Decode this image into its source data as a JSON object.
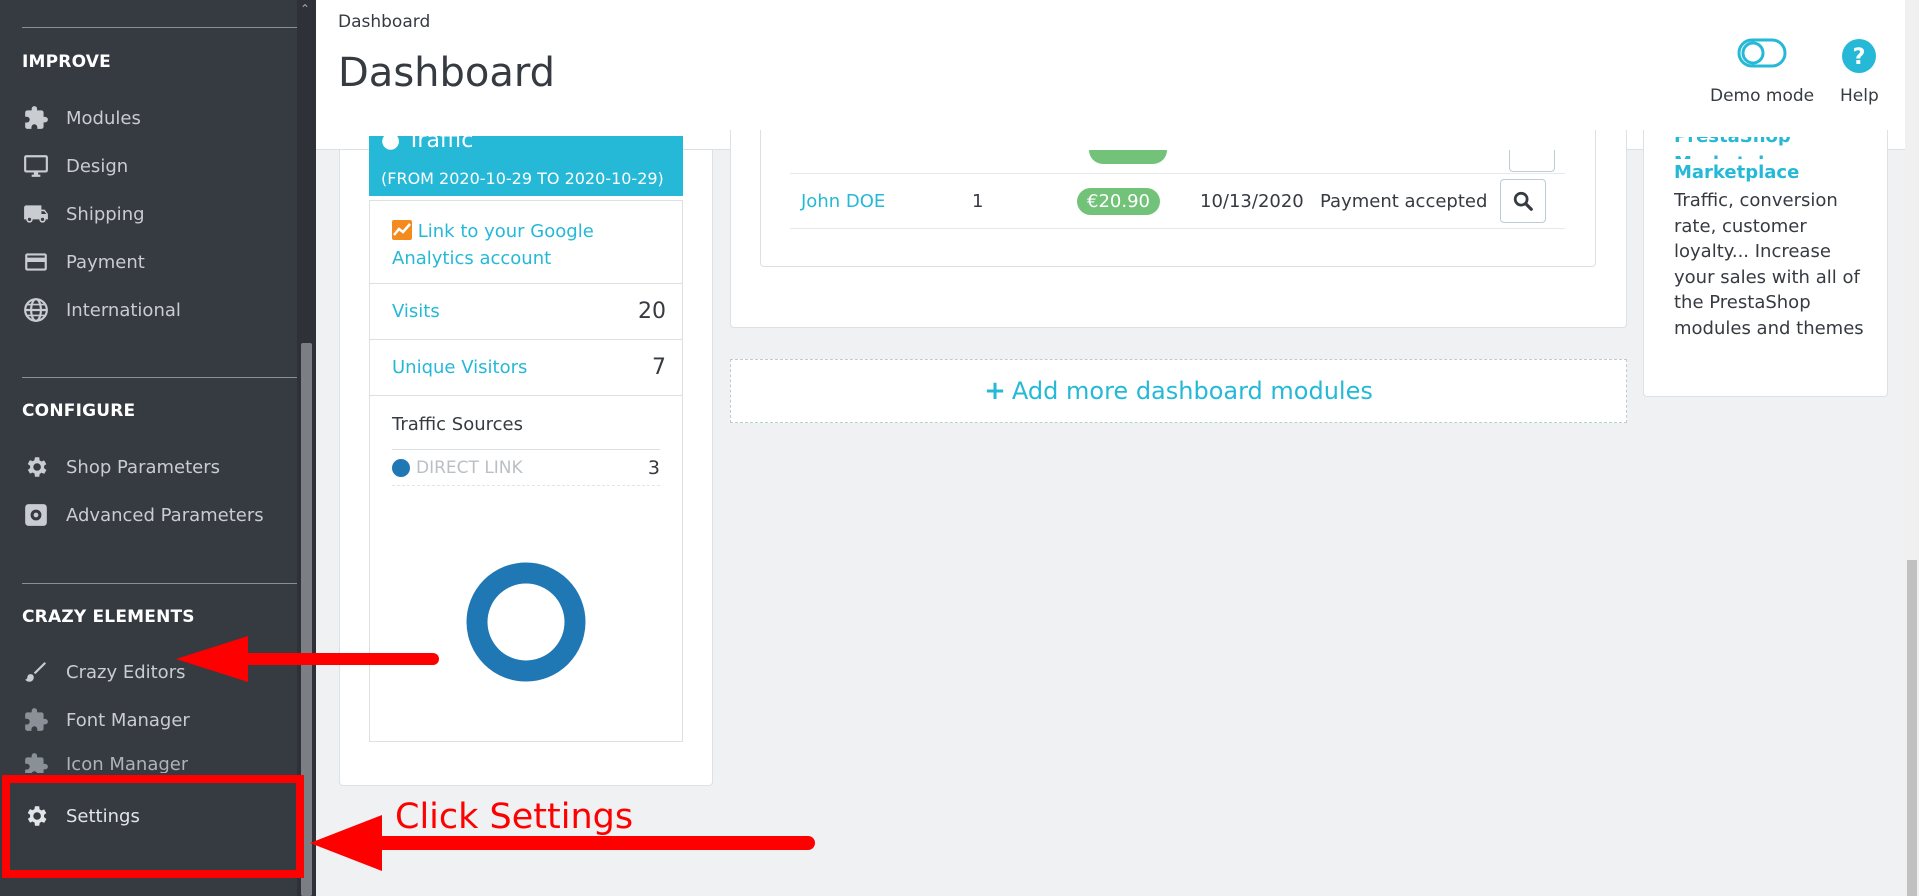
{
  "sidebar": {
    "sections": [
      {
        "title": "IMPROVE",
        "items": [
          {
            "label": "Modules",
            "icon": "puzzle-icon"
          },
          {
            "label": "Design",
            "icon": "monitor-icon"
          },
          {
            "label": "Shipping",
            "icon": "truck-icon"
          },
          {
            "label": "Payment",
            "icon": "credit-card-icon"
          },
          {
            "label": "International",
            "icon": "globe-icon"
          }
        ]
      },
      {
        "title": "CONFIGURE",
        "items": [
          {
            "label": "Shop Parameters",
            "icon": "gear-icon"
          },
          {
            "label": "Advanced Parameters",
            "icon": "gear-box-icon"
          }
        ]
      },
      {
        "title": "CRAZY ELEMENTS",
        "items": [
          {
            "label": "Crazy Editors",
            "icon": "brush-icon"
          },
          {
            "label": "Font Manager",
            "icon": "puzzle-icon"
          },
          {
            "label": "Icon Manager",
            "icon": "puzzle-icon"
          },
          {
            "label": "Settings",
            "icon": "gear-icon"
          }
        ]
      }
    ]
  },
  "header": {
    "breadcrumb": "Dashboard",
    "title": "Dashboard",
    "demo_mode": "Demo mode",
    "help": "Help"
  },
  "analytics": {
    "title": "Traffic",
    "range": "(FROM 2020-10-29 TO 2020-10-29)",
    "google_link": "Link to your Google Analytics account",
    "visits_label": "Visits",
    "visits_value": "20",
    "unique_label": "Unique Visitors",
    "unique_value": "7",
    "sources_label": "Traffic Sources",
    "source_name": "DIRECT LINK",
    "source_value": "3"
  },
  "orders": {
    "row": {
      "customer": "John DOE",
      "qty": "1",
      "total": "€20.90",
      "date": "10/13/2020",
      "status": "Payment accepted"
    }
  },
  "add_more": "Add more dashboard modules",
  "marketplace": {
    "title": "PrestaShop Marketplace",
    "text": "Traffic, conversion rate, customer loyalty... Increase your sales with all of the PrestaShop modules and themes"
  },
  "annotation": {
    "text": "Click Settings",
    "color": "#ff0000"
  },
  "colors": {
    "sidebar_bg": "#363a41",
    "accent": "#25b9d7",
    "badge_green": "#72c279",
    "donut": "#1f77b4"
  }
}
